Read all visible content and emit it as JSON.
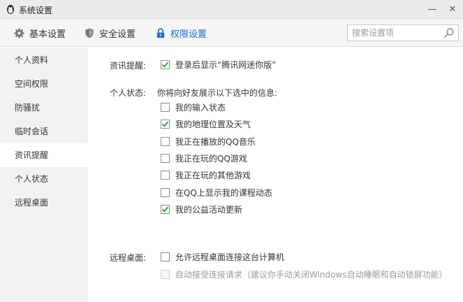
{
  "window": {
    "title": "系统设置",
    "min_glyph": "—",
    "close_glyph": "✕"
  },
  "toolbar": {
    "tabs": [
      {
        "label": "基本设置",
        "icon": "gear-icon"
      },
      {
        "label": "安全设置",
        "icon": "shield-icon"
      },
      {
        "label": "权限设置",
        "icon": "lock-icon",
        "active": true
      }
    ],
    "search": {
      "placeholder": "搜索设置项",
      "value": ""
    }
  },
  "sidebar": {
    "items": [
      {
        "label": "个人资料"
      },
      {
        "label": "空间权限"
      },
      {
        "label": "防骚扰"
      },
      {
        "label": "临时会话"
      },
      {
        "label": "资讯提醒",
        "active": true
      },
      {
        "label": "个人状态"
      },
      {
        "label": "远程桌面"
      }
    ]
  },
  "main": {
    "news": {
      "label": "资讯提醒:",
      "option": {
        "label": "登录后显示“腾讯网迷你版”",
        "checked": true
      }
    },
    "status": {
      "label": "个人状态:",
      "intro": "你将向好友展示以下选中的信息:",
      "options": [
        {
          "label": "我的输入状态",
          "checked": false
        },
        {
          "label": "我的地理位置及天气",
          "checked": true
        },
        {
          "label": "我正在播放的QQ音乐",
          "checked": false
        },
        {
          "label": "我正在玩的QQ游戏",
          "checked": false
        },
        {
          "label": "我正在玩的其他游戏",
          "checked": false
        },
        {
          "label": "在QQ上显示我的课程动态",
          "checked": false
        },
        {
          "label": "我的公益活动更新",
          "checked": true
        }
      ]
    },
    "remote": {
      "label": "远程桌面:",
      "options": [
        {
          "label": "允许远程桌面连接这台计算机",
          "checked": false,
          "disabled": false
        },
        {
          "label": "自动接受连接请求（建议你手动关闭Windows自动睡眠和自动锁屏功能）",
          "checked": false,
          "disabled": true
        }
      ]
    }
  },
  "colors": {
    "accent": "#1a6fd0",
    "check": "#2aa142",
    "sidebar_bg": "#f2f2f2"
  }
}
